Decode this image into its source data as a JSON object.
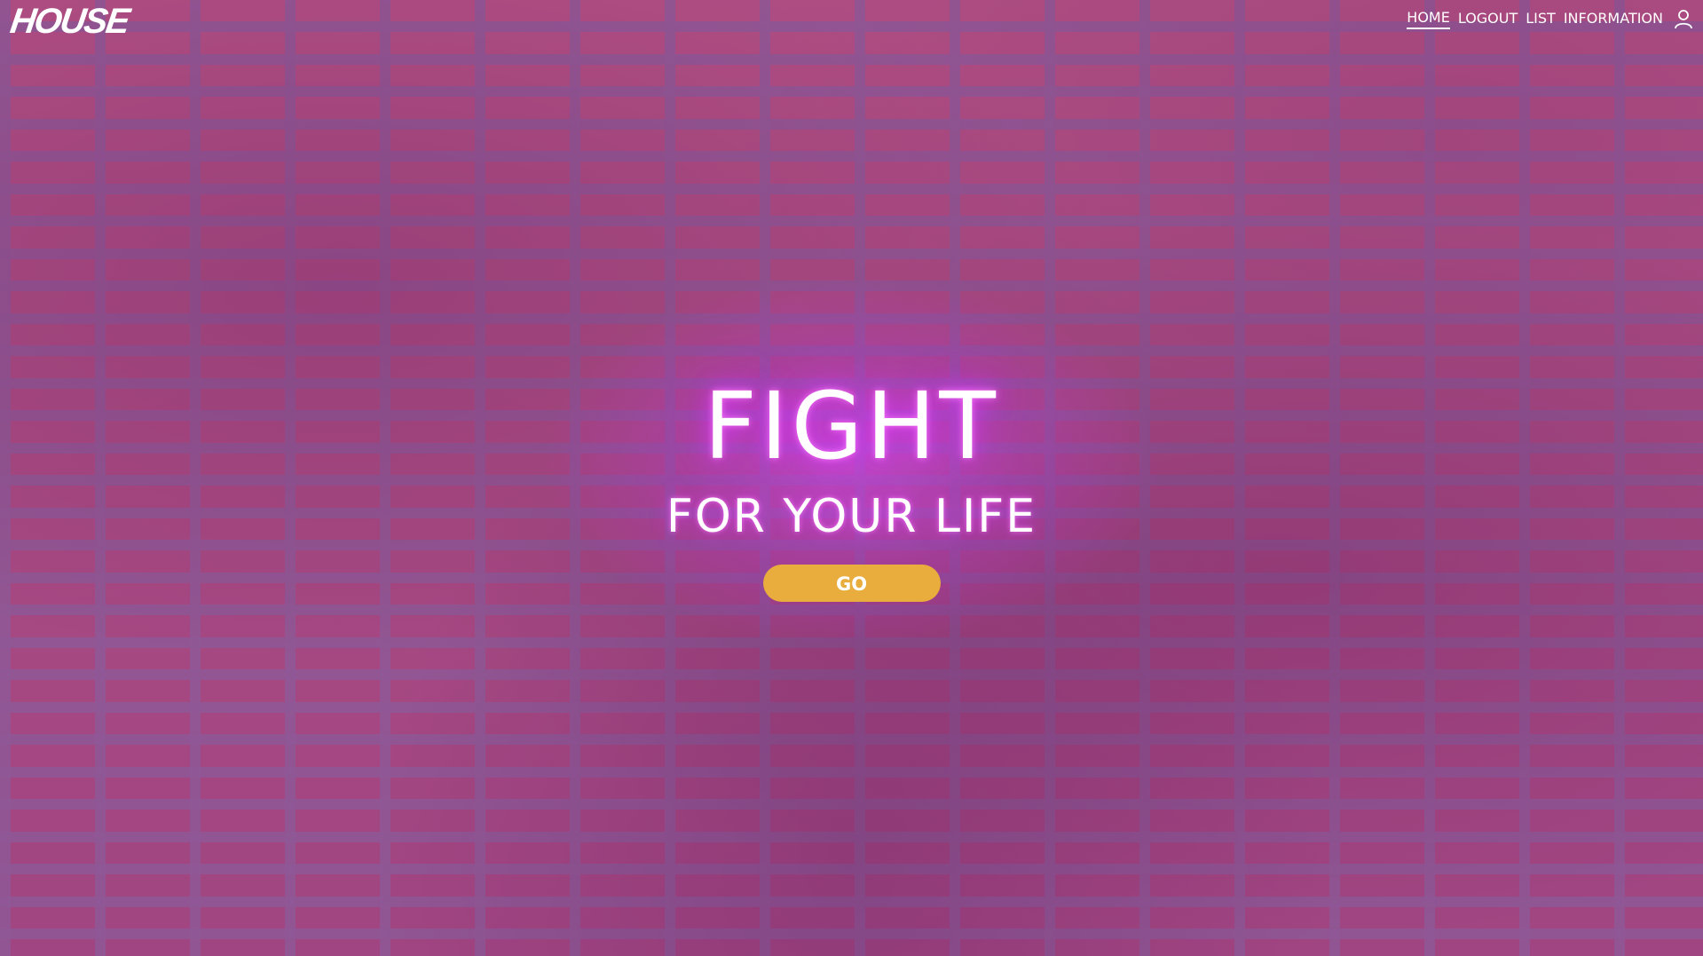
{
  "header": {
    "logo": "HOUSE",
    "nav": [
      {
        "label": "HOME",
        "active": true
      },
      {
        "label": "LOGOUT",
        "active": false
      },
      {
        "label": "LIST",
        "active": false
      },
      {
        "label": "INFORMATION",
        "active": false
      }
    ],
    "user_icon": "user-icon"
  },
  "hero": {
    "title": "FIGHT",
    "subtitle": "FOR YOUR LIFE",
    "button_label": "GO"
  },
  "colors": {
    "accent": "#e8ad3c",
    "glow": "#dc50ff",
    "overlay": "#8228a0",
    "text": "#ffffff"
  }
}
